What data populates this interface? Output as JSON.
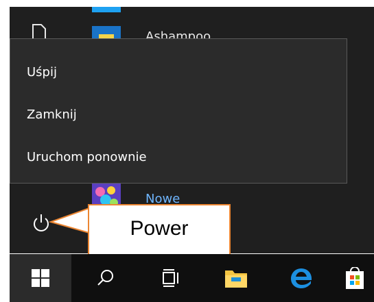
{
  "power_menu": {
    "items": [
      "Uśpij",
      "Zamknij",
      "Uruchom ponownie"
    ]
  },
  "apps": {
    "ashampoo_label": "Ashampoo",
    "nowe_label": "Nowe"
  },
  "callout": {
    "text": "Power"
  },
  "icons": {
    "document": "document-icon",
    "power": "power-icon",
    "start": "windows-start-icon",
    "search": "search-icon",
    "task_view": "task-view-icon",
    "file_explorer": "file-explorer-icon",
    "edge": "edge-icon",
    "store": "store-icon"
  },
  "colors": {
    "start_bg": "#1f1f1f",
    "menu_bg": "#2b2b2b",
    "taskbar_bg": "#0f0f0f",
    "accent": "#0078d7",
    "callout_border": "#ec8632"
  }
}
